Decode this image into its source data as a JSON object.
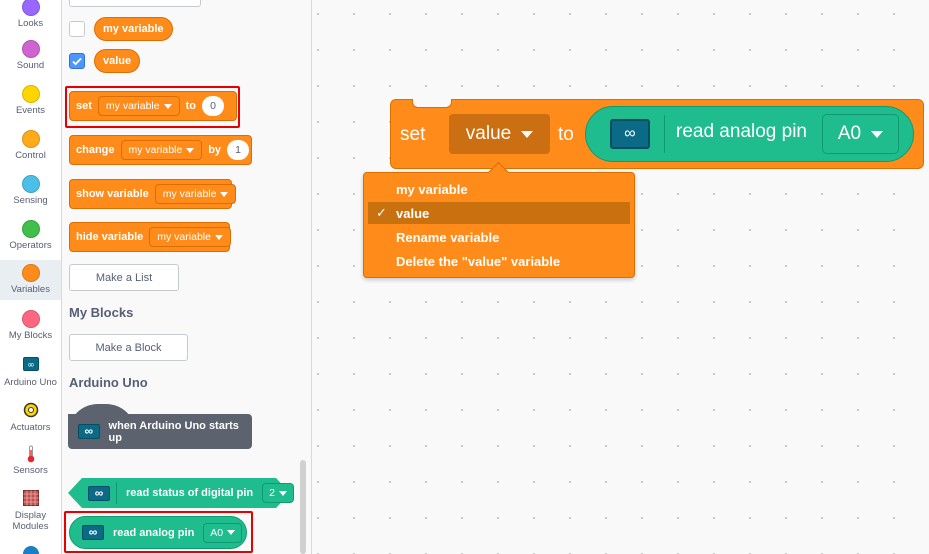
{
  "categories": [
    {
      "name": "looks",
      "label": "Looks",
      "color": "#9966ff"
    },
    {
      "name": "sound",
      "label": "Sound",
      "color": "#cf63cf"
    },
    {
      "name": "events",
      "label": "Events",
      "color": "#ffd500"
    },
    {
      "name": "control",
      "label": "Control",
      "color": "#ffab19"
    },
    {
      "name": "sensing",
      "label": "Sensing",
      "color": "#4cbfe6"
    },
    {
      "name": "operators",
      "label": "Operators",
      "color": "#40bf4a"
    },
    {
      "name": "variables",
      "label": "Variables",
      "color": "#ff8c1a"
    },
    {
      "name": "my-blocks",
      "label": "My Blocks",
      "color": "#ff6680"
    },
    {
      "name": "arduino",
      "label": "Arduino Uno",
      "icon": "arduino-board-icon"
    },
    {
      "name": "actuators",
      "label": "Actuators",
      "icon": "gear-icon"
    },
    {
      "name": "sensors",
      "label": "Sensors",
      "icon": "thermometer-icon"
    },
    {
      "name": "display",
      "label": "Display Modules",
      "label_lines": [
        "Display",
        "Modules"
      ],
      "icon": "grid-display-icon"
    }
  ],
  "selected_category": "Variables",
  "palette": {
    "variables": [
      {
        "label": "my variable",
        "checked": false
      },
      {
        "label": "value",
        "checked": true
      }
    ],
    "set_block": {
      "verb": "set",
      "var": "my variable",
      "to": "to",
      "value": "0"
    },
    "change_block": {
      "verb": "change",
      "var": "my variable",
      "by": "by",
      "value": "1"
    },
    "show_block": {
      "verb": "show variable",
      "var": "my variable"
    },
    "hide_block": {
      "verb": "hide variable",
      "var": "my variable"
    },
    "make_list": "Make a List",
    "my_blocks_title": "My Blocks",
    "make_block": "Make a Block",
    "arduino_title": "Arduino Uno",
    "hat_block": "when Arduino Uno starts up",
    "digital_block": {
      "label": "read status of digital pin",
      "value": "2"
    },
    "analog_block": {
      "label": "read analog pin",
      "value": "A0"
    }
  },
  "workspace": {
    "block": {
      "set": "set",
      "var": "value",
      "to": "to",
      "reporter": "read analog pin",
      "pin": "A0"
    },
    "menu": {
      "items": [
        "my variable",
        "value",
        "Rename variable",
        "Delete the \"value\" variable"
      ],
      "selected_index": 1,
      "check": "✓"
    }
  },
  "colors": {
    "variables": "#ff8c1a",
    "arduino": "#1fbd8d",
    "highlight": "#e60000"
  }
}
